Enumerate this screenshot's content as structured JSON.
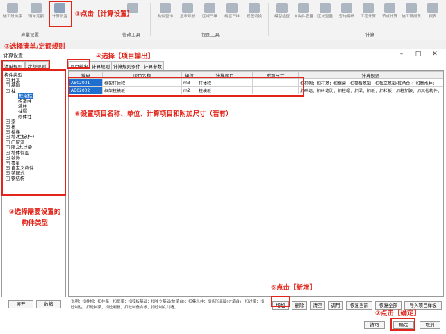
{
  "ribbon": {
    "buttons": [
      "施工段排序",
      "清单定额",
      "计算设置",
      "",
      "",
      "",
      "",
      "",
      "构件查询",
      "显示导航",
      "区域三维",
      "楼层三维",
      "视图切换",
      "模型检查",
      "单构件查量",
      "区域查量",
      "查询明细",
      "工程计算",
      "节点计算",
      "施工段报表",
      "报表"
    ],
    "groups": [
      "算量设置",
      "修改工具",
      "视图工具",
      "计算"
    ]
  },
  "annotations": {
    "a1": "①点击【计算设置】",
    "a2": "②选择清单/定额规则",
    "a3": "③选择需要设置的构件类型",
    "a4": "④选择【项目输出】",
    "a5": "⑤点击【新增】",
    "a6": "⑥设置项目名称、单位、计算项目和附加尺寸（若有）",
    "a7": "⑦点击【确定】"
  },
  "dialog": {
    "title": "计算设置",
    "left_tabs": [
      "清单规则",
      "定额规则"
    ],
    "tree_title": "构件类型",
    "tree": [
      {
        "label": "柱基",
        "level": 0,
        "pm": "+"
      },
      {
        "label": "基础",
        "level": 0,
        "pm": "+"
      },
      {
        "label": "柱",
        "level": 0,
        "pm": "-"
      },
      {
        "label": "框架柱",
        "level": 1,
        "sel": true
      },
      {
        "label": "构造柱",
        "level": 1
      },
      {
        "label": "墙柱",
        "level": 1
      },
      {
        "label": "柱帽",
        "level": 1
      },
      {
        "label": "砌体柱",
        "level": 1
      },
      {
        "label": "梁",
        "level": 0,
        "pm": "+"
      },
      {
        "label": "板",
        "level": 0,
        "pm": "+"
      },
      {
        "label": "楼梯",
        "level": 0,
        "pm": "+"
      },
      {
        "label": "墙,栏板(杆)",
        "level": 0,
        "pm": "+"
      },
      {
        "label": "门窗洞",
        "level": 0,
        "pm": "+"
      },
      {
        "label": "圈,过,过梁",
        "level": 0,
        "pm": "+"
      },
      {
        "label": "墙体保温",
        "level": 0,
        "pm": "+"
      },
      {
        "label": "装饰",
        "level": 0,
        "pm": "+"
      },
      {
        "label": "零星",
        "level": 0,
        "pm": "+"
      },
      {
        "label": "自定义构件",
        "level": 0,
        "pm": "+"
      },
      {
        "label": "装配式",
        "level": 0,
        "pm": "+"
      },
      {
        "label": "钢结构",
        "level": 0,
        "pm": "+"
      }
    ],
    "expand_label": "展开",
    "collapse_label": "收缩",
    "right_tabs": [
      "项目输出",
      "计算规则",
      "计算规则条件",
      "计算参数"
    ],
    "columns": [
      "编码",
      "项目名称",
      "单位",
      "计算项目",
      "附加尺寸",
      "计算规则"
    ],
    "rows": [
      {
        "code": "AB02001",
        "name": "框架柱体积",
        "unit": "m3",
        "item": "柱体积",
        "extra": "",
        "rule": "扣柱帽；扣柱基；扣框梁；扣筏板基础；扣独立基础(桩承台)；扣集水井；"
      },
      {
        "code": "AB02002",
        "name": "框架柱模板",
        "unit": "m2",
        "item": "柱模板",
        "extra": "",
        "rule": "扣砼墙；扣砼墙肋；扣柱帽；扣梁；扣板；扣栏板；扣柱加腋；扣其他构件；"
      }
    ],
    "description": "说明：扣柱帽；扣柱基；扣框梁；扣筏板基础；扣独立基础(桩承台)；扣集水井；扣条形基础(桩承台)；扣过梁；扣砼制柱；扣砼制梁；扣砼制板；扣砼制叠合板；扣砼制女儿墙；",
    "buttons": [
      "增加",
      "删除",
      "清空",
      "调用",
      "恢复当前",
      "恢复全部",
      "导入项目样板"
    ],
    "footer": [
      "技巧",
      "确定",
      "取消"
    ]
  }
}
